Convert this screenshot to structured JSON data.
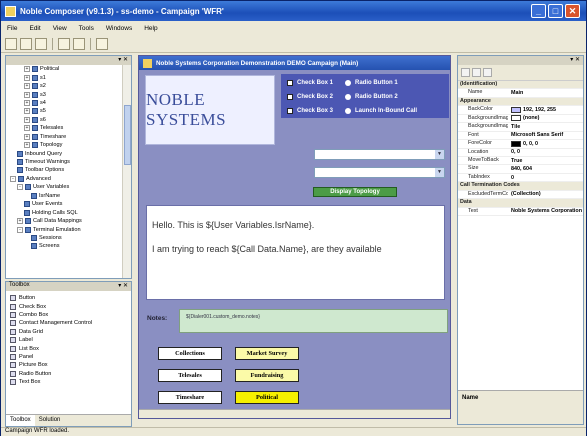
{
  "window": {
    "title": "Noble Composer (v9.1.3) - ss-demo - Campaign 'WFR'"
  },
  "menu": [
    "File",
    "Edit",
    "View",
    "Tools",
    "Windows",
    "Help"
  ],
  "tree": {
    "header": "",
    "items": [
      {
        "label": "Political",
        "indent": 2,
        "exp": "+"
      },
      {
        "label": "s1",
        "indent": 2,
        "exp": "+"
      },
      {
        "label": "s2",
        "indent": 2,
        "exp": "+"
      },
      {
        "label": "s3",
        "indent": 2,
        "exp": "+"
      },
      {
        "label": "s4",
        "indent": 2,
        "exp": "+"
      },
      {
        "label": "s5",
        "indent": 2,
        "exp": "+"
      },
      {
        "label": "s6",
        "indent": 2,
        "exp": "+"
      },
      {
        "label": "Telesales",
        "indent": 2,
        "exp": "+"
      },
      {
        "label": "Timeshare",
        "indent": 2,
        "exp": "+"
      },
      {
        "label": "Topology",
        "indent": 2,
        "exp": "+"
      },
      {
        "label": "Inbound Query",
        "indent": 1,
        "exp": ""
      },
      {
        "label": "Timeout Warnings",
        "indent": 1,
        "exp": ""
      },
      {
        "label": "Toolbar Options",
        "indent": 1,
        "exp": ""
      },
      {
        "label": "Advanced",
        "indent": 0,
        "exp": "-"
      },
      {
        "label": "User Variables",
        "indent": 1,
        "exp": "-"
      },
      {
        "label": "IsrName",
        "indent": 3,
        "exp": ""
      },
      {
        "label": "User Events",
        "indent": 2,
        "exp": ""
      },
      {
        "label": "Holding Calls SQL",
        "indent": 2,
        "exp": ""
      },
      {
        "label": "Call Data Mappings",
        "indent": 1,
        "exp": "+"
      },
      {
        "label": "Terminal Emulation",
        "indent": 1,
        "exp": "-"
      },
      {
        "label": "Sessions",
        "indent": 3,
        "exp": ""
      },
      {
        "label": "Screens",
        "indent": 3,
        "exp": ""
      }
    ]
  },
  "toolbox": {
    "title": "Toolbox",
    "items": [
      "Button",
      "Check Box",
      "Combo Box",
      "Contact Management Control",
      "Data Grid",
      "Label",
      "List Box",
      "Panel",
      "Picture Box",
      "Radio Button",
      "Text Box"
    ],
    "tabs": [
      "Toolbox",
      "Solution"
    ]
  },
  "designer": {
    "form_title": "Noble Systems Corporation   Demonstration DEMO Campaign (Main)",
    "logo_text": "NOBLE SYSTEMS",
    "checkboxes": [
      "Check Box 1",
      "Check Box 2",
      "Check Box 3"
    ],
    "radios": [
      "Radio Button 1",
      "Radio Button 2",
      "Launch In-Bound Call"
    ],
    "topology_button": "Display Topology",
    "script_line1": "Hello. This is ${User Variables.IsrName}.",
    "script_line2": "I am trying to reach ${Call Data.Name}, are they available",
    "notes_label": "Notes:",
    "notes_value": "${Dialer001.custom_demo.notes}",
    "buttons": [
      {
        "label": "Collections",
        "color": "#ffffff"
      },
      {
        "label": "Market Survey",
        "color": "#fbfaa8"
      },
      {
        "label": "Telesales",
        "color": "#ffffff"
      },
      {
        "label": "Fundraising",
        "color": "#fbfaa8"
      },
      {
        "label": "Timeshare",
        "color": "#ffffff"
      },
      {
        "label": "Political",
        "color": "#f6f000"
      }
    ]
  },
  "properties": {
    "rows": [
      {
        "type": "cat",
        "key": "(Identification)"
      },
      {
        "key": "Name",
        "value": "Main"
      },
      {
        "type": "cat",
        "key": "Appearance"
      },
      {
        "key": "BackColor",
        "value": "192, 192, 255",
        "swatch": "#c0c0ff"
      },
      {
        "key": "BackgroundImage",
        "value": "(none)",
        "swatch": "#ffffff"
      },
      {
        "key": "BackgroundImageLayout",
        "value": "Tile"
      },
      {
        "key": "Font",
        "value": "Microsoft Sans Serif"
      },
      {
        "key": "ForeColor",
        "value": "0, 0, 0",
        "swatch": "#000000"
      },
      {
        "key": "Location",
        "value": "0, 0"
      },
      {
        "key": "MoveToBack",
        "value": "True"
      },
      {
        "key": "Size",
        "value": "840, 604"
      },
      {
        "key": "TabIndex",
        "value": "0"
      },
      {
        "type": "cat",
        "key": "Call Termination Codes"
      },
      {
        "key": "ExcludedTermCodes",
        "value": "(Collection)"
      },
      {
        "type": "cat",
        "key": "Data"
      },
      {
        "key": "Text",
        "value": "Noble Systems Corporation"
      }
    ],
    "description_title": "Name"
  },
  "status": "Campaign WFR loaded."
}
